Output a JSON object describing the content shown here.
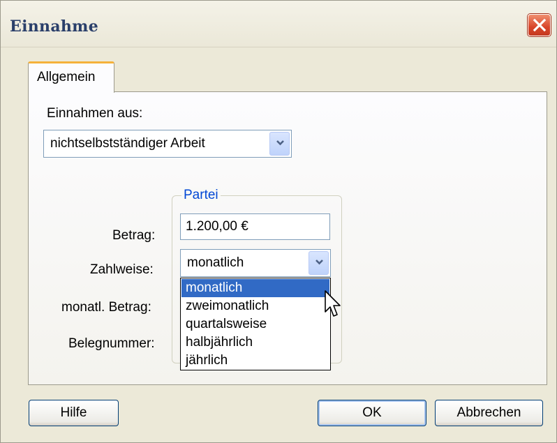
{
  "window": {
    "title": "Einnahme"
  },
  "tabs": [
    {
      "label": "Allgemein"
    }
  ],
  "source": {
    "label": "Einnahmen aus:",
    "value": "nichtselbstständiger Arbeit"
  },
  "group": {
    "title": "Partei",
    "betrag_label": "Betrag:",
    "betrag_value": "1.200,00 €",
    "zahlweise_label": "Zahlweise:",
    "zahlweise_value": "monatlich",
    "monatl_label": "monatl. Betrag:",
    "beleg_label": "Belegnummer:"
  },
  "zahlweise_options": [
    {
      "label": "monatlich"
    },
    {
      "label": "zweimonatlich"
    },
    {
      "label": "quartalsweise"
    },
    {
      "label": "halbjährlich"
    },
    {
      "label": "jährlich"
    }
  ],
  "buttons": {
    "help": "Hilfe",
    "ok": "OK",
    "cancel": "Abbrechen"
  },
  "colors": {
    "selection": "#316ac5",
    "group_title": "#0046d5",
    "tab_accent": "#f5b13a",
    "close": "#d8452a"
  }
}
